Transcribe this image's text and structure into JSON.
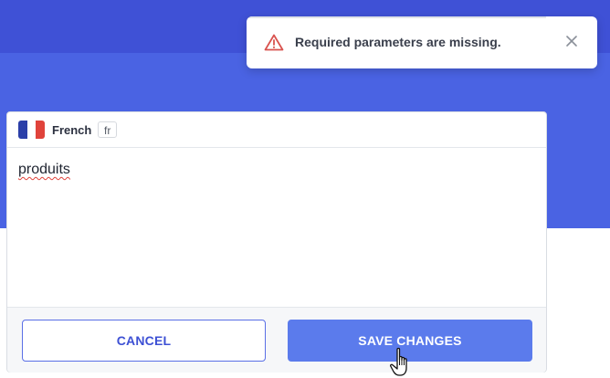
{
  "toast": {
    "message": "Required parameters are missing.",
    "icon": "warning-triangle-icon",
    "icon_color": "#d9534f",
    "close_icon": "close-icon"
  },
  "editor": {
    "language": {
      "name": "French",
      "code": "fr",
      "flag_colors": [
        "#2b3fa8",
        "#ffffff",
        "#e0433b"
      ]
    },
    "content": "produits"
  },
  "actions": {
    "cancel_label": "CANCEL",
    "save_label": "SAVE CHANGES"
  },
  "colors": {
    "header_bg": "#3f51d6",
    "band_bg": "#4a63e3",
    "primary": "#5b7bec"
  }
}
